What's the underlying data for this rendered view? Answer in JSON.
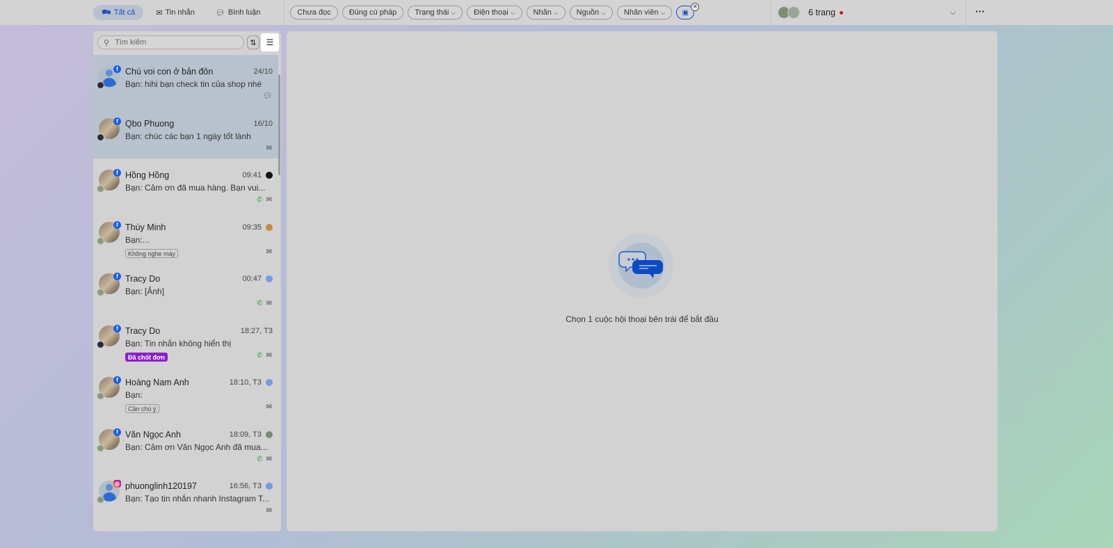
{
  "topbar": {
    "tabs": [
      {
        "label": "Tất cả",
        "icon": "chat-icon",
        "active": true
      },
      {
        "label": "Tin nhắn",
        "icon": "mail-icon"
      },
      {
        "label": "Bình luận",
        "icon": "comment-icon"
      }
    ],
    "filters": [
      {
        "label": "Chưa đọc",
        "dropdown": false
      },
      {
        "label": "Đúng cú pháp",
        "dropdown": false
      },
      {
        "label": "Trạng thái",
        "dropdown": true
      },
      {
        "label": "Điện thoại",
        "dropdown": true
      },
      {
        "label": "Nhãn",
        "dropdown": true
      },
      {
        "label": "Nguồn",
        "dropdown": true
      },
      {
        "label": "Nhân viên",
        "dropdown": true
      }
    ],
    "pages_label": "6 trang",
    "more": "···"
  },
  "sidebar": {
    "search_placeholder": "Tìm kiếm",
    "conversations": [
      {
        "name": "Chú voi con ở bản đôn",
        "time": "24/10",
        "message": "Bạn: hihi bạn check tin của shop nhé",
        "platform": "facebook",
        "selected": true,
        "icons": [
          "comment"
        ]
      },
      {
        "name": "Qbo Phuong",
        "time": "16/10",
        "message": "Bạn: chúc các bạn 1 ngày tốt lành",
        "platform": "facebook",
        "selected": true,
        "icons": [
          "mail"
        ]
      },
      {
        "name": "Hồng Hồng",
        "time": "09:41",
        "message": "Bạn: Cảm ơn đã mua hàng. Bạn vui...",
        "platform": "facebook",
        "icons": [
          "phone",
          "mail"
        ]
      },
      {
        "name": "Thùy Minh",
        "time": "09:35",
        "message": "Bạn:...",
        "platform": "facebook",
        "tag": "Không nghe máy",
        "icons": [
          "mail"
        ]
      },
      {
        "name": "Tracy Do",
        "time": "00:47",
        "message": "Bạn: [Ảnh]",
        "platform": "facebook",
        "icons": [
          "phone",
          "mail"
        ]
      },
      {
        "name": "Tracy Do",
        "time": "18:27, T3",
        "message": "Bạn: Tin nhắn không hiển thị",
        "platform": "facebook",
        "tag": "Đã chốt đơn",
        "tag_color": "#8b1fc9",
        "icons": [
          "phone",
          "mail"
        ]
      },
      {
        "name": "Hoàng Nam Anh",
        "time": "18:10, T3",
        "message": "Bạn:",
        "platform": "facebook",
        "tag": "Cần chú ý",
        "icons": [
          "mail"
        ]
      },
      {
        "name": "Văn Ngọc Anh",
        "time": "18:09, T3",
        "message": "Bạn: Cảm ơn Văn Ngọc Anh đã mua...",
        "platform": "facebook",
        "icons": [
          "phone",
          "mail"
        ]
      },
      {
        "name": "phuonglinh120197",
        "time": "16:56, T3",
        "message": "Bạn: Tạo tin nhắn nhanh Instagram T...",
        "platform": "instagram",
        "icons": [
          "mail"
        ]
      }
    ]
  },
  "main": {
    "empty_text": "Chọn 1 cuộc hội thoại bên trái để bắt đầu"
  },
  "colors": {
    "accent": "#1a4fbf",
    "facebook": "#1a5ee8",
    "selected_row": "#b8c2ce",
    "notification_dot": "#e0101e"
  }
}
